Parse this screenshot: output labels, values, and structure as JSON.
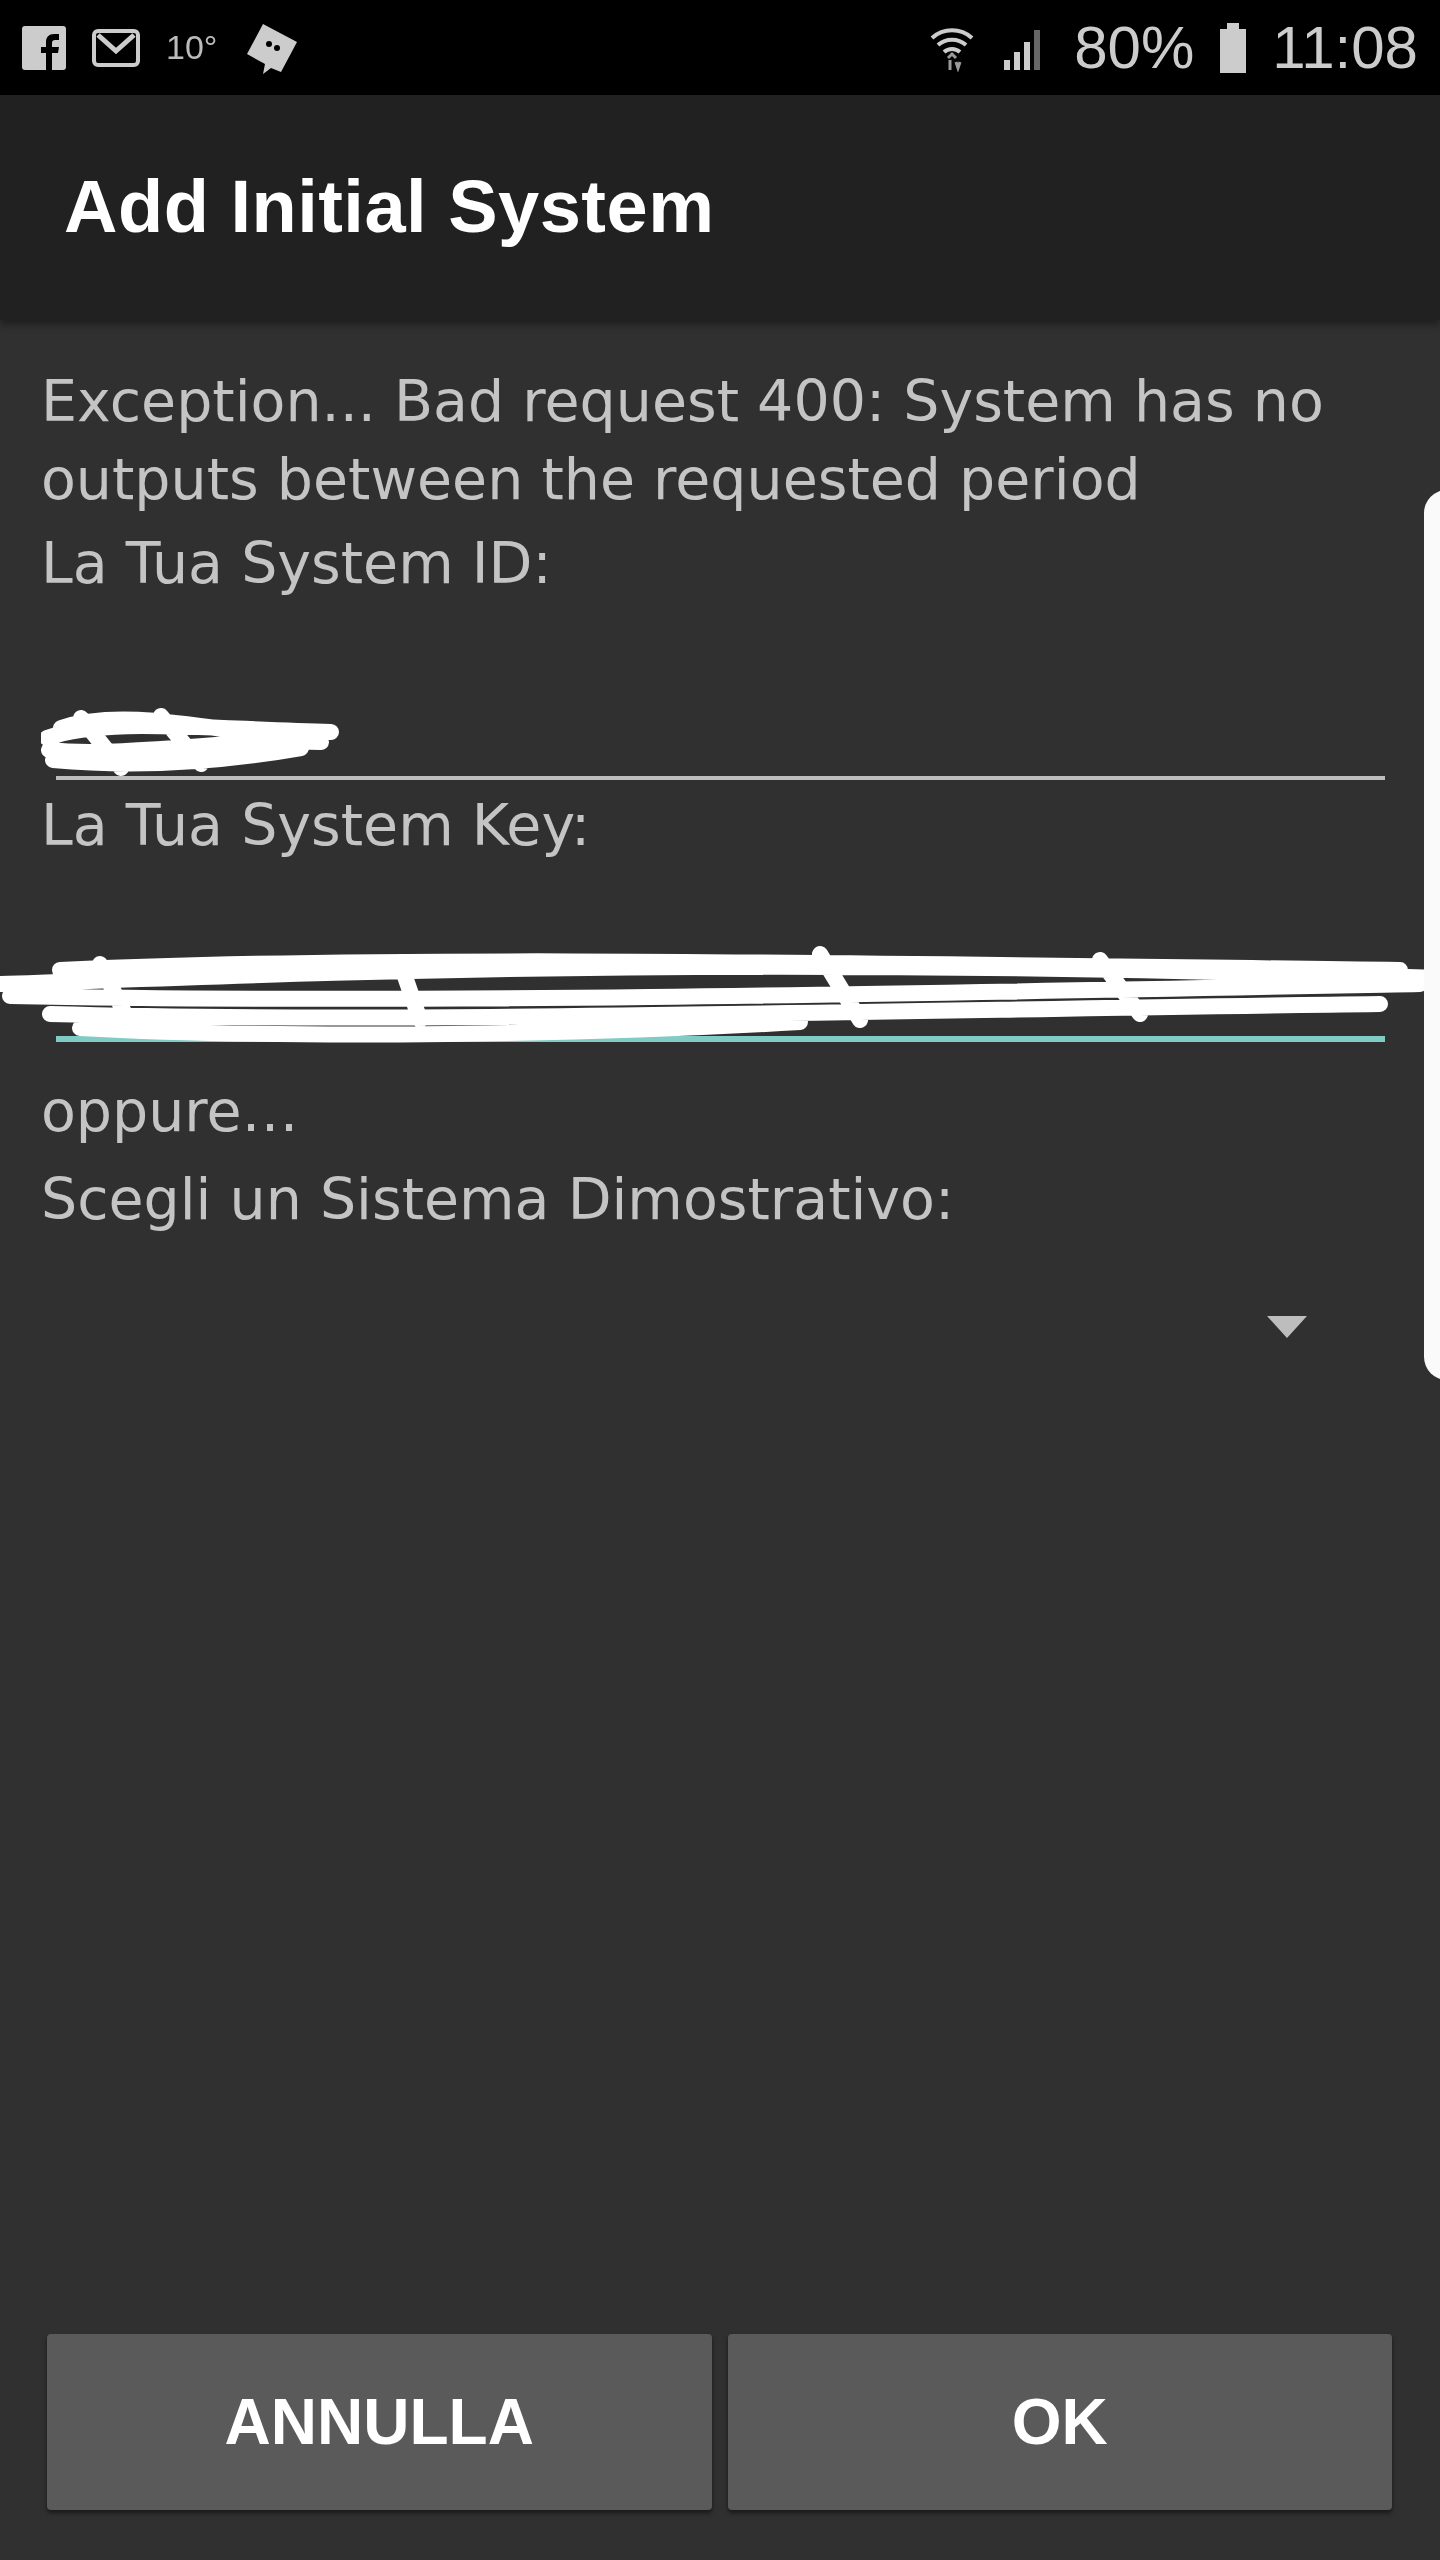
{
  "status_bar": {
    "temperature": "10°",
    "battery": "80%",
    "time": "11:08"
  },
  "title": "Add Initial System",
  "message": "Exception... Bad request 400: System has no outputs between the requested period",
  "fields": [
    {
      "label": "La Tua System ID:",
      "focused": false
    },
    {
      "label": "La Tua System Key:",
      "focused": true
    }
  ],
  "separator": "oppure…",
  "demo_label": "Scegli un Sistema Dimostrativo:",
  "buttons": [
    "ANNULLA",
    "OK"
  ]
}
